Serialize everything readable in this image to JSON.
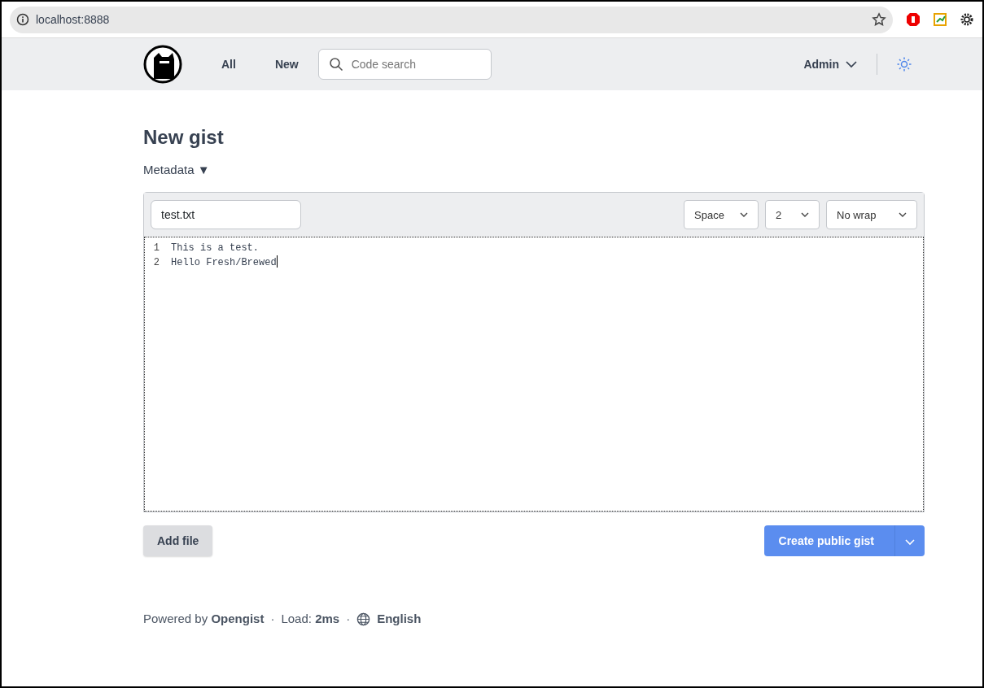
{
  "browser": {
    "url": "localhost:8888"
  },
  "nav": {
    "links": [
      "All",
      "New"
    ],
    "search": {
      "placeholder": "Code search"
    },
    "user": "Admin"
  },
  "page": {
    "title": "New gist",
    "metadata": {
      "label": "Metadata",
      "arrow": "▼"
    }
  },
  "editor": {
    "filename": "test.txt",
    "indent_style": "Space",
    "indent_size": "2",
    "wrap": "No wrap",
    "lines": [
      {
        "number": "1",
        "text": "This is a test."
      },
      {
        "number": "2",
        "text": "Hello Fresh/Brewed"
      }
    ]
  },
  "buttons": {
    "add_file": "Add file",
    "create": "Create public gist"
  },
  "footer": {
    "powered": "Powered by **Opengist**",
    "sep1": "·",
    "load": "Load: **2ms**",
    "sep2": "·",
    "language": "English"
  }
}
